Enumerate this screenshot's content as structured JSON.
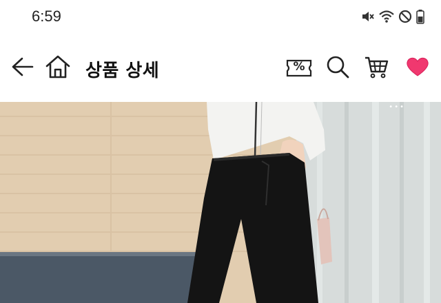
{
  "status_bar": {
    "time": "6:59",
    "icons": [
      "mute-icon",
      "wifi-icon",
      "dnd-icon",
      "battery-icon"
    ]
  },
  "header": {
    "title": "상품 상세",
    "left_icons": [
      "back-arrow-icon",
      "home-icon"
    ],
    "right_icons": [
      "coupon-icon",
      "search-icon",
      "cart-icon",
      "heart-icon"
    ],
    "coupon_icon_text": "%"
  },
  "colors": {
    "heart": "#f0386f",
    "icon_stroke": "#222222",
    "wall": "#e2cdb0",
    "skirting": "#4b5866",
    "curtain": "#d7dcdb"
  },
  "product_image": {
    "subject": "model-photo",
    "carousel_indicator": "•••"
  }
}
